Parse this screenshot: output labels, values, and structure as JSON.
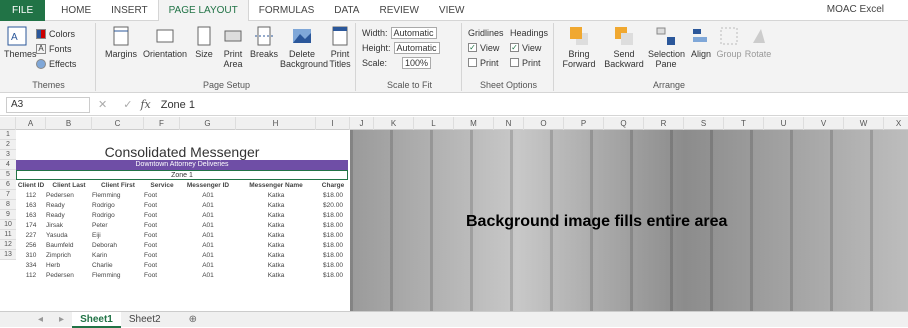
{
  "tabs": [
    "FILE",
    "HOME",
    "INSERT",
    "PAGE LAYOUT",
    "FORMULAS",
    "DATA",
    "REVIEW",
    "VIEW"
  ],
  "account": "MOAC Excel",
  "ribbon": {
    "themes": {
      "themes": "Themes",
      "colors": "Colors",
      "fonts": "Fonts",
      "effects": "Effects",
      "label": "Themes"
    },
    "page_setup": {
      "margins": "Margins",
      "orientation": "Orientation",
      "size": "Size",
      "print_area": "Print Area",
      "breaks": "Breaks",
      "background": "Delete Background",
      "print_titles": "Print Titles",
      "label": "Page Setup"
    },
    "scale": {
      "width_label": "Width:",
      "width_val": "Automatic",
      "height_label": "Height:",
      "height_val": "Automatic",
      "scale_label": "Scale:",
      "scale_val": "100%",
      "label": "Scale to Fit"
    },
    "sheet_options": {
      "gridlines": "Gridlines",
      "headings": "Headings",
      "view": "View",
      "print": "Print",
      "label": "Sheet Options"
    },
    "arrange": {
      "bring": "Bring Forward",
      "send": "Send Backward",
      "selection": "Selection Pane",
      "align": "Align",
      "group": "Group",
      "rotate": "Rotate",
      "label": "Arrange"
    }
  },
  "formula": {
    "cell": "A3",
    "value": "Zone 1"
  },
  "columns": [
    "A",
    "B",
    "C",
    "F",
    "G",
    "H",
    "I",
    "J",
    "K",
    "L",
    "M",
    "N",
    "O",
    "P",
    "Q",
    "R",
    "S",
    "T",
    "U",
    "V",
    "W",
    "X"
  ],
  "rows": [
    "1",
    "2",
    "3",
    "4",
    "5",
    "6",
    "7",
    "8",
    "9",
    "10",
    "11",
    "12",
    "13"
  ],
  "sheet": {
    "title": "Consolidated Messenger",
    "subtitle": "Downtown Attorney Deliveries",
    "zone": "Zone 1",
    "headers": [
      "Client ID",
      "Client Last",
      "Client First",
      "Service",
      "Messenger ID",
      "Messenger Name",
      "Charge"
    ],
    "rows": [
      [
        "112",
        "Pedersen",
        "Flemming",
        "Foot",
        "A01",
        "Katka",
        "$18.00"
      ],
      [
        "163",
        "Ready",
        "Rodrigo",
        "Foot",
        "A01",
        "Katka",
        "$20.00"
      ],
      [
        "163",
        "Ready",
        "Rodrigo",
        "Foot",
        "A01",
        "Katka",
        "$18.00"
      ],
      [
        "174",
        "Jirsak",
        "Peter",
        "Foot",
        "A01",
        "Katka",
        "$18.00"
      ],
      [
        "227",
        "Yasuda",
        "Eiji",
        "Foot",
        "A01",
        "Katka",
        "$18.00"
      ],
      [
        "256",
        "Baumfeld",
        "Deborah",
        "Foot",
        "A01",
        "Katka",
        "$18.00"
      ],
      [
        "310",
        "Zimprich",
        "Karin",
        "Foot",
        "A01",
        "Katka",
        "$18.00"
      ],
      [
        "334",
        "Herb",
        "Charlie",
        "Foot",
        "A01",
        "Katka",
        "$18.00"
      ],
      [
        "112",
        "Pedersen",
        "Flemming",
        "Foot",
        "A01",
        "Katka",
        "$18.00"
      ]
    ]
  },
  "overlay": "Background image fills entire area",
  "sheet_tabs": [
    "Sheet1",
    "Sheet2"
  ],
  "add_sheet": "⊕"
}
